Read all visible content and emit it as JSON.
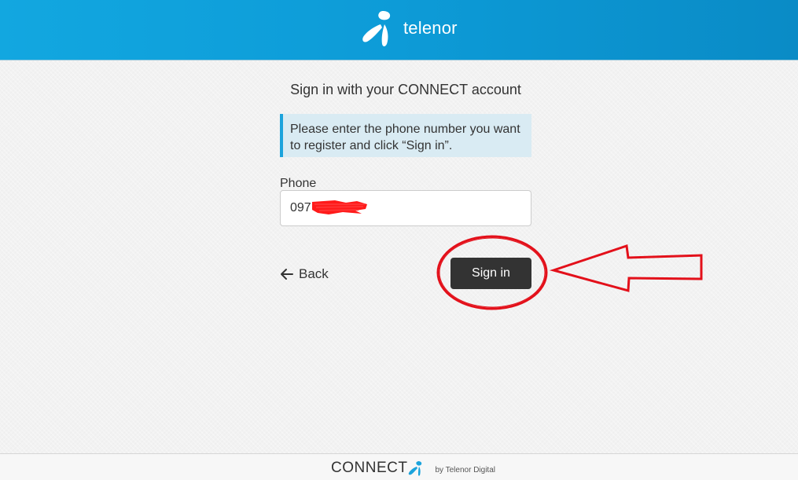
{
  "header": {
    "brand_name": "telenor",
    "brand_color": "#0d9bd7"
  },
  "main": {
    "title": "Sign in with your CONNECT account",
    "info_message": "Please enter the phone number you want to register and click “Sign in”.",
    "phone_label": "Phone",
    "phone_value": "097",
    "back_label": "Back",
    "signin_label": "Sign in",
    "button_color": "#333333"
  },
  "annotation": {
    "color": "#e3101a",
    "shapes": [
      "circle-around-sign-in",
      "arrow-pointing-left"
    ]
  },
  "footer": {
    "connect_label": "CONNECT",
    "byline": "by Telenor Digital"
  },
  "icons": {
    "brand": "telenor-propeller-icon",
    "back": "arrow-left-icon",
    "footer": "connect-mark-icon"
  }
}
